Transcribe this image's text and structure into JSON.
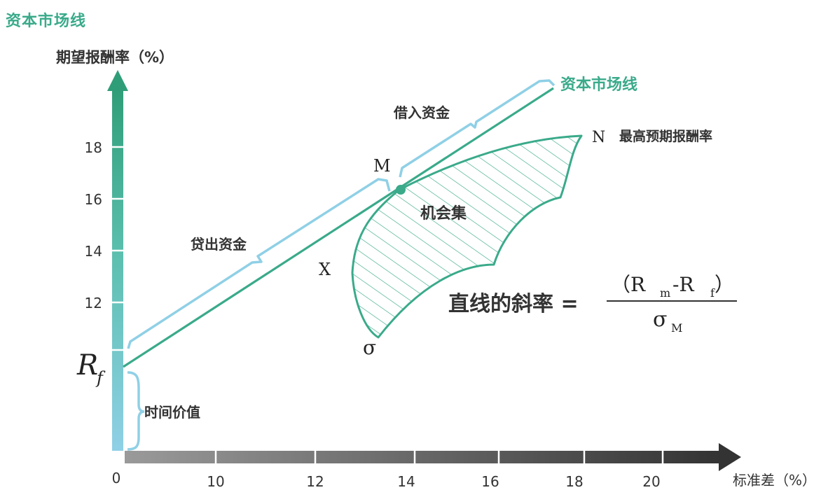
{
  "title": "资本市场线",
  "y_axis_title": "期望报酬率（%）",
  "x_axis_title": "标准差（%）",
  "y_ticks": [
    "18",
    "16",
    "14",
    "12"
  ],
  "x_ticks": [
    "0",
    "10",
    "12",
    "14",
    "16",
    "18",
    "20"
  ],
  "labels": {
    "cml": "资本市场线",
    "borrow": "借入资金",
    "lend": "贷出资金",
    "opportunity_set": "机会集",
    "time_value": "时间价值",
    "highest": "最高预期报酬率",
    "point_m": "M",
    "point_n": "N",
    "point_x": "X",
    "point_sigma": "σ",
    "rf_main": "R",
    "rf_sub": "f"
  },
  "formula": {
    "lhs": "直线的斜率 =",
    "numerator": "（R",
    "num_sub_m": "m",
    "num_mid": "-R",
    "num_sub_f": "f",
    "num_close": "）",
    "denominator": "σ",
    "den_sub": "M"
  },
  "colors": {
    "green": "#3aaa8a",
    "light_blue": "#8fd0e6",
    "axis_gray": "#666666"
  }
}
